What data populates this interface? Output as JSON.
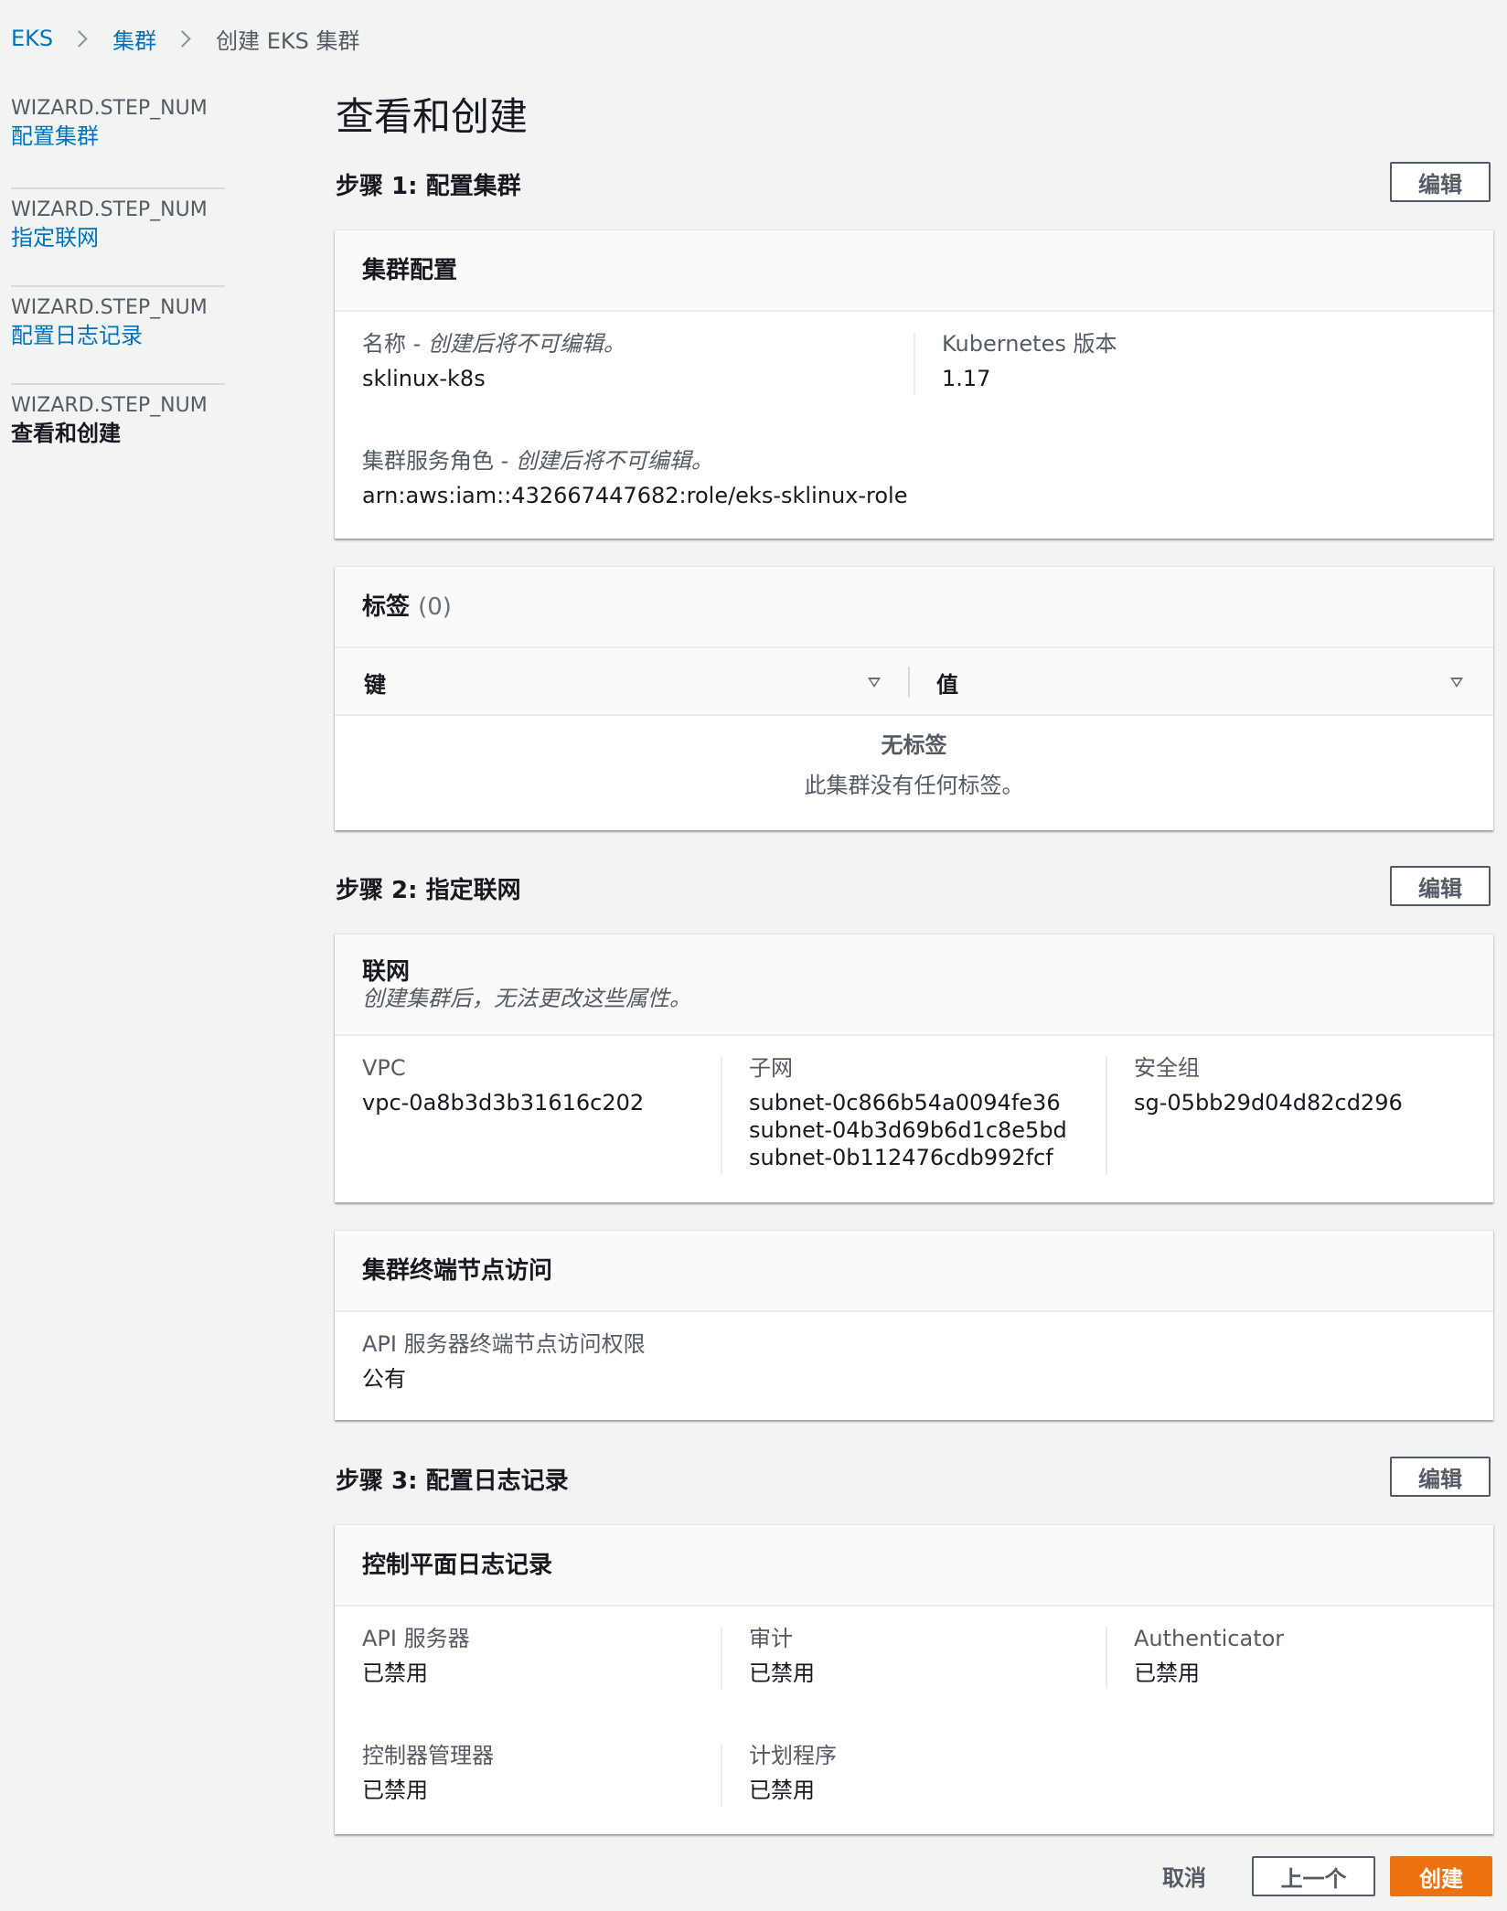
{
  "breadcrumb": {
    "root": "EKS",
    "parent": "集群",
    "current": "创建 EKS 集群"
  },
  "side_nav": {
    "steps": [
      {
        "num": "WIZARD.STEP_NUM",
        "label": "配置集群"
      },
      {
        "num": "WIZARD.STEP_NUM",
        "label": "指定联网"
      },
      {
        "num": "WIZARD.STEP_NUM",
        "label": "配置日志记录"
      },
      {
        "num": "WIZARD.STEP_NUM",
        "label": "查看和创建"
      }
    ]
  },
  "page_title": "查看和创建",
  "edit_label": "编辑",
  "step1": {
    "heading": "步骤 1: 配置集群",
    "cluster_config": {
      "title": "集群配置",
      "name_label": "名称 - ",
      "name_label_note": "创建后将不可编辑。",
      "name_value": "sklinux-k8s",
      "version_label": "Kubernetes 版本",
      "version_value": "1.17",
      "role_label": "集群服务角色 - ",
      "role_label_note": "创建后将不可编辑。",
      "role_value": "arn:aws:iam::432667447682:role/eks-sklinux-role"
    },
    "tags": {
      "title": "标签",
      "count": "(0)",
      "col_key": "键",
      "col_value": "值",
      "empty_title": "无标签",
      "empty_desc": "此集群没有任何标签。"
    }
  },
  "step2": {
    "heading": "步骤 2: 指定联网",
    "networking": {
      "title": "联网",
      "desc": "创建集群后，无法更改这些属性。",
      "vpc_label": "VPC",
      "vpc_value": "vpc-0a8b3d3b31616c202",
      "subnet_label": "子网",
      "subnets": [
        "subnet-0c866b54a0094fe36",
        "subnet-04b3d69b6d1c8e5bd",
        "subnet-0b112476cdb992fcf"
      ],
      "sg_label": "安全组",
      "sg_value": "sg-05bb29d04d82cd296"
    },
    "endpoint": {
      "title": "集群终端节点访问",
      "label": "API 服务器终端节点访问权限",
      "value": "公有"
    }
  },
  "step3": {
    "heading": "步骤 3: 配置日志记录",
    "logging": {
      "title": "控制平面日志记录",
      "items": [
        {
          "label": "API 服务器",
          "value": "已禁用"
        },
        {
          "label": "审计",
          "value": "已禁用"
        },
        {
          "label": "Authenticator",
          "value": "已禁用"
        },
        {
          "label": "控制器管理器",
          "value": "已禁用"
        },
        {
          "label": "计划程序",
          "value": "已禁用"
        }
      ]
    }
  },
  "footer": {
    "cancel": "取消",
    "previous": "上一个",
    "create": "创建"
  },
  "colors": {
    "link": "#0073bb",
    "primary": "#ec7211",
    "background": "#f2f3f3"
  }
}
